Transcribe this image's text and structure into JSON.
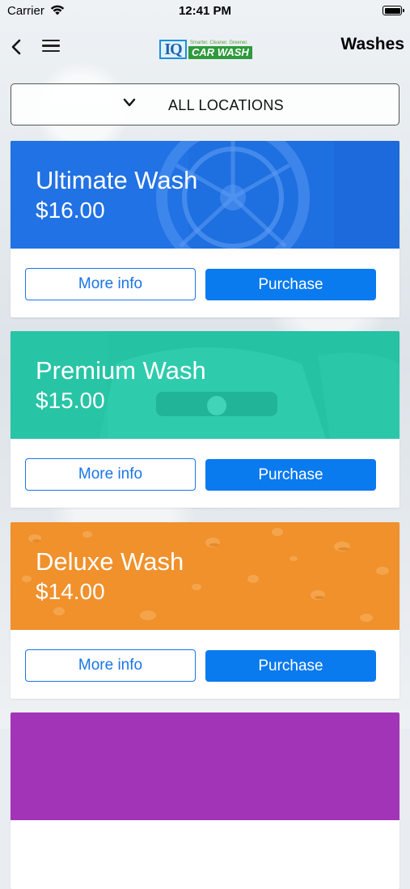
{
  "status_bar": {
    "carrier": "Carrier",
    "time": "12:41 PM"
  },
  "nav": {
    "title": "Washes",
    "logo": {
      "mark": "IQ",
      "tagline": "Smarter. Cleaner. Greener.",
      "text": "CAR WASH"
    }
  },
  "location": {
    "label": "ALL LOCATIONS"
  },
  "cards": [
    {
      "name": "Ultimate Wash",
      "price": "$16.00",
      "more_info": "More info",
      "purchase": "Purchase",
      "color": "#1e6fe0"
    },
    {
      "name": "Premium Wash",
      "price": "$15.00",
      "more_info": "More info",
      "purchase": "Purchase",
      "color": "#25c2a4"
    },
    {
      "name": "Deluxe Wash",
      "price": "$14.00",
      "more_info": "More info",
      "purchase": "Purchase",
      "color": "#f0912c"
    },
    {
      "color": "#a234b8"
    }
  ]
}
